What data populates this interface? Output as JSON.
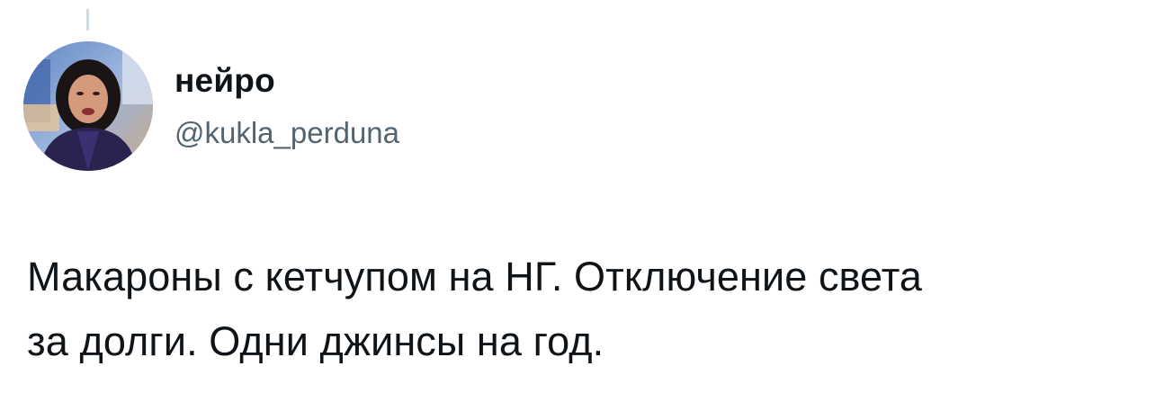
{
  "author": {
    "display_name": "нейро",
    "handle": "@kukla_perduna",
    "avatar_icon": "profile-photo"
  },
  "tweet": {
    "lines": [
      "Макароны с кетчупом на НГ. Отключение света",
      "за долги. Одни джинсы на год."
    ]
  },
  "colors": {
    "text": "#0f1419",
    "secondary_text": "#536471",
    "thread_line": "#cfd9de",
    "background": "#ffffff"
  }
}
